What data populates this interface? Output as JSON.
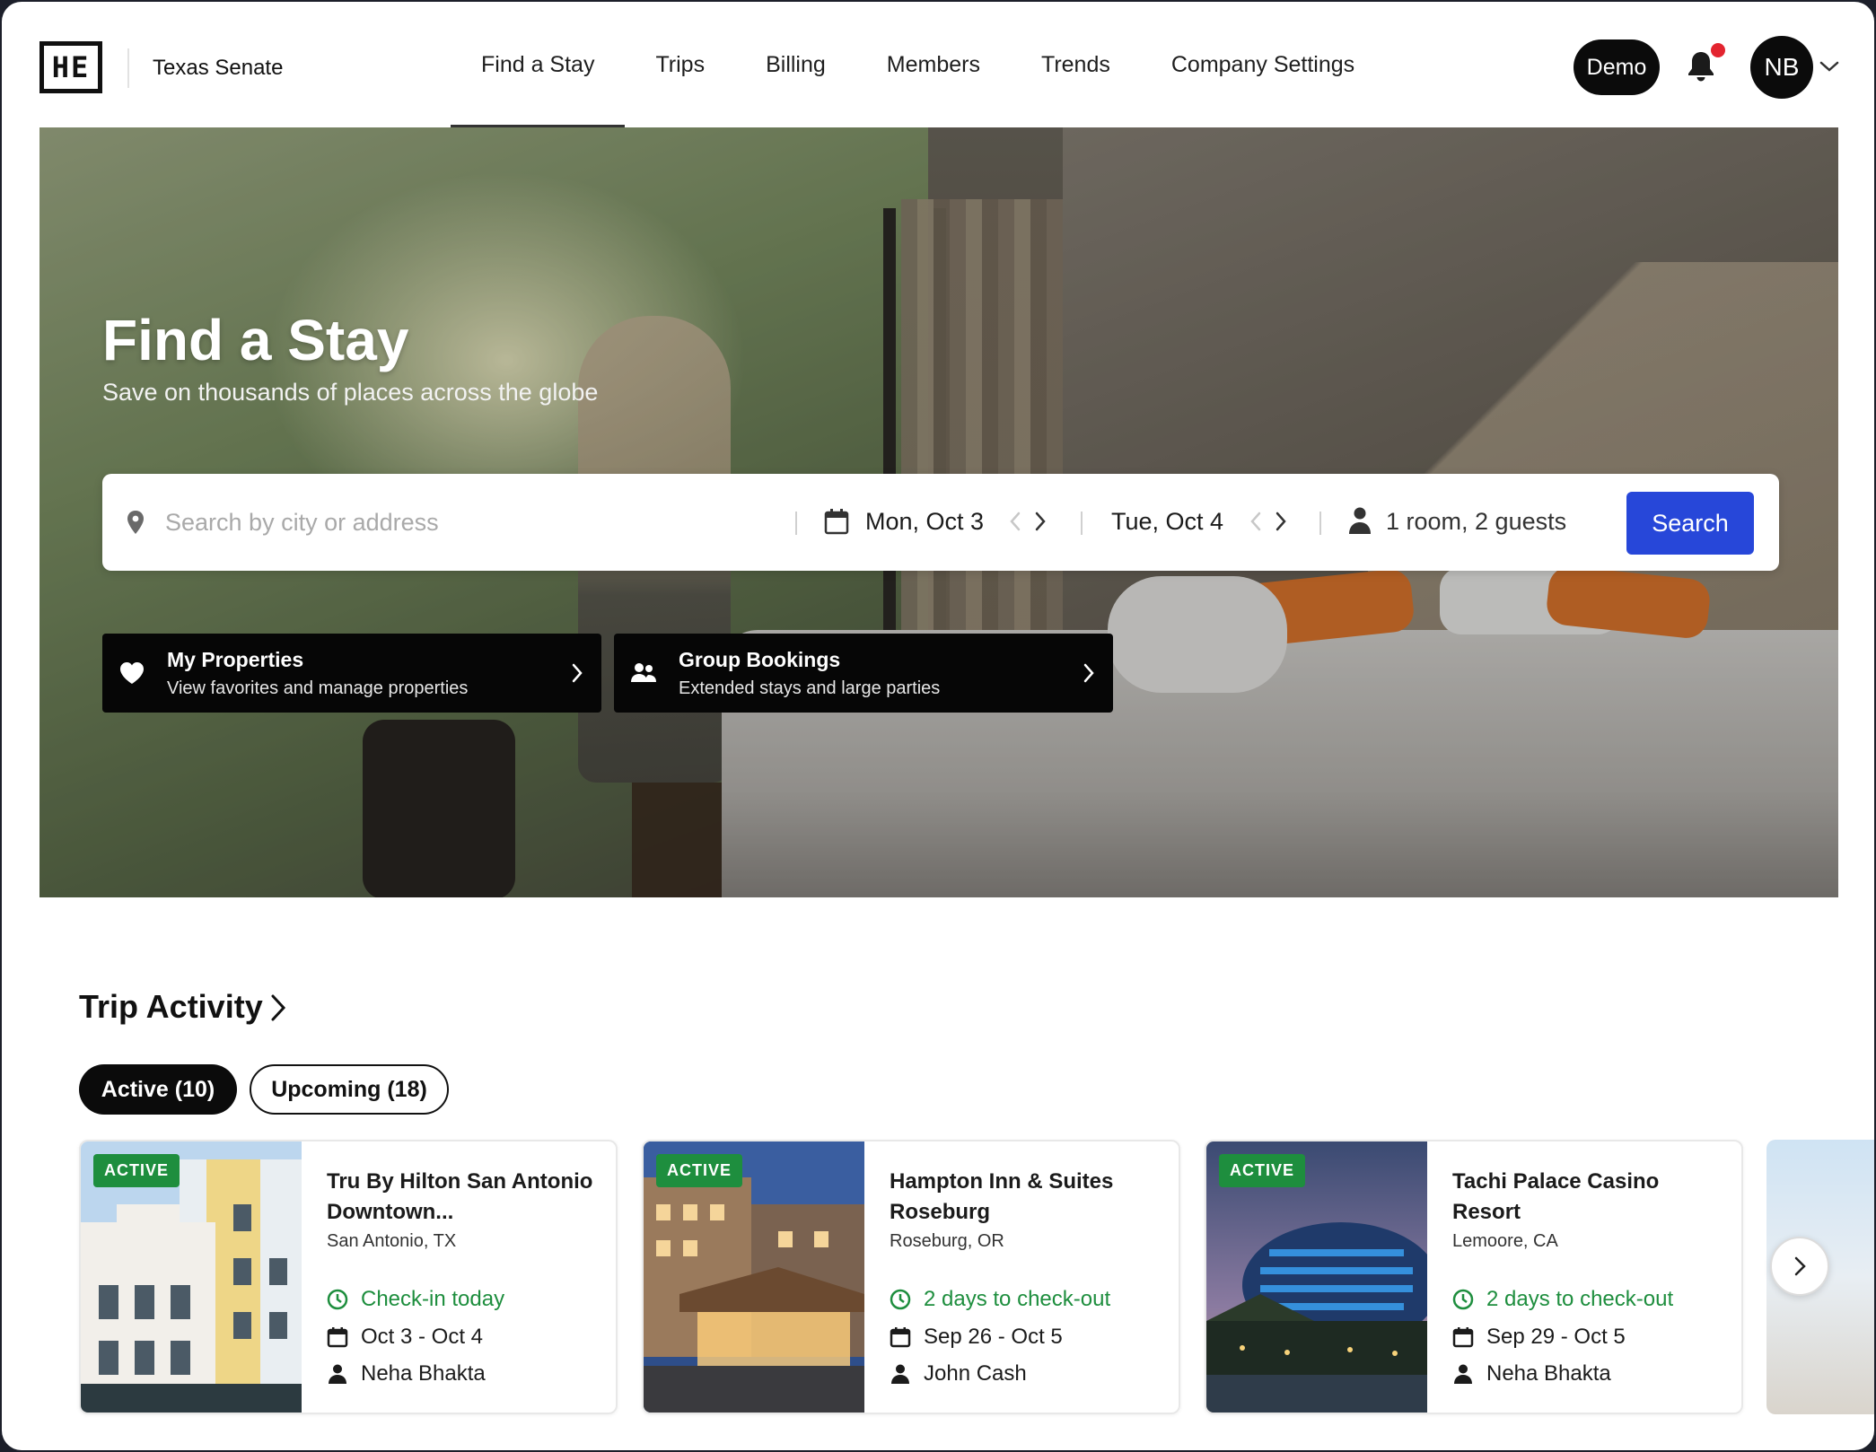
{
  "header": {
    "logo_text": "HE",
    "org_name": "Texas Senate",
    "nav": [
      {
        "label": "Find a Stay",
        "active": true
      },
      {
        "label": "Trips"
      },
      {
        "label": "Billing"
      },
      {
        "label": "Members"
      },
      {
        "label": "Trends"
      },
      {
        "label": "Company Settings"
      }
    ],
    "demo_label": "Demo",
    "notification_icon": "bell-icon",
    "has_unread_notifications": true,
    "avatar_initials": "NB"
  },
  "hero": {
    "title": "Find a Stay",
    "subtitle": "Save on thousands of places across the globe",
    "search": {
      "placeholder": "Search by city or address",
      "value": "",
      "check_in": "Mon, Oct 3",
      "check_out": "Tue, Oct 4",
      "guests": "1 room, 2 guests",
      "button_label": "Search"
    },
    "cards": [
      {
        "title": "My Properties",
        "subtitle": "View favorites and manage properties",
        "icon": "heart-icon"
      },
      {
        "title": "Group Bookings",
        "subtitle": "Extended stays and large parties",
        "icon": "group-icon"
      }
    ]
  },
  "trip_activity": {
    "title": "Trip Activity",
    "tabs": [
      {
        "label": "Active (10)",
        "active": true
      },
      {
        "label": "Upcoming (18)",
        "active": false
      }
    ],
    "trips": [
      {
        "badge": "ACTIVE",
        "name": "Tru By Hilton San Antonio Downtown...",
        "location": "San Antonio, TX",
        "status": "Check-in today",
        "dates": "Oct 3 - Oct 4",
        "guest": "Neha Bhakta"
      },
      {
        "badge": "ACTIVE",
        "name": "Hampton Inn & Suites Roseburg",
        "location": "Roseburg, OR",
        "status": "2 days to check-out",
        "dates": "Sep 26 - Oct 5",
        "guest": "John Cash"
      },
      {
        "badge": "ACTIVE",
        "name": "Tachi Palace Casino Resort",
        "location": "Lemoore, CA",
        "status": "2 days to check-out",
        "dates": "Sep 29 - Oct 5",
        "guest": "Neha Bhakta"
      }
    ]
  },
  "colors": {
    "primary_button": "#2747d9",
    "active_badge": "#1e8e3e",
    "status_text": "#1e8e3e",
    "notification_dot": "#e3242f"
  }
}
